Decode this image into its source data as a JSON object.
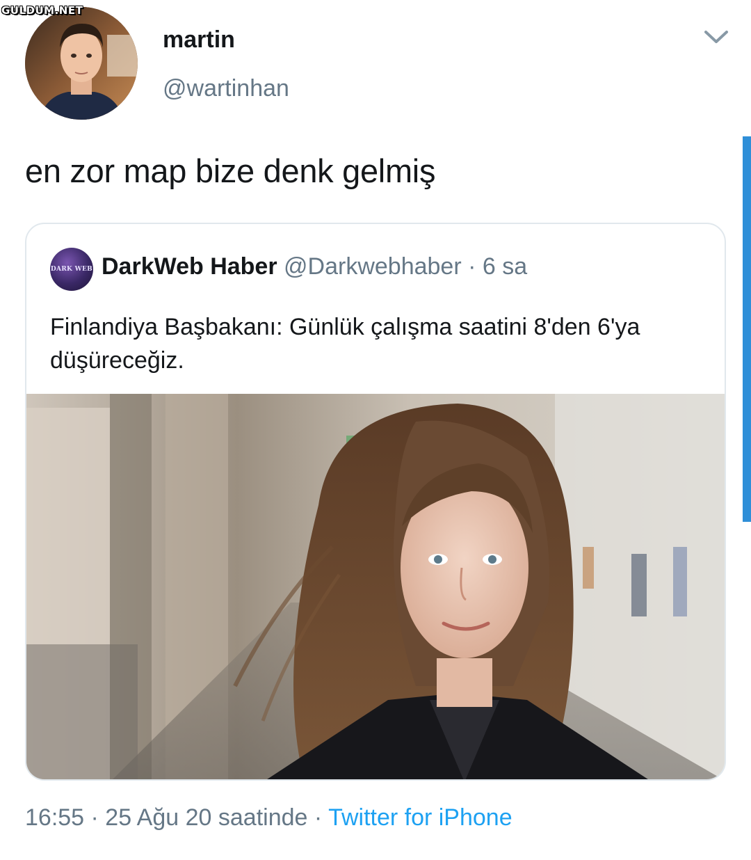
{
  "watermark": "GULDUM.NET",
  "tweet": {
    "author_name": "martin",
    "author_handle": "@wartinhan",
    "text": "en zor map bize denk gelmiş",
    "timestamp": "16:55 · 25 Ağu 20 saatinde",
    "separator": " · ",
    "source": "Twitter for iPhone",
    "menu_icon": "chevron-down-icon"
  },
  "quoted_tweet": {
    "author_name": "DarkWeb Haber",
    "author_handle": "@Darkwebhaber",
    "separator": "·",
    "age": "6 sa",
    "avatar_text": "DARK WEB",
    "text_line1": "Finlandiya Başbakanı: Günlük çalışma saatini 8'den 6'ya",
    "text_line2": "düşüreceğiz."
  },
  "colors": {
    "text": "#14171a",
    "secondary": "#657786",
    "link": "#1da1f2",
    "border": "#e1e8ed",
    "scrollbar": "#2f8fd8"
  }
}
